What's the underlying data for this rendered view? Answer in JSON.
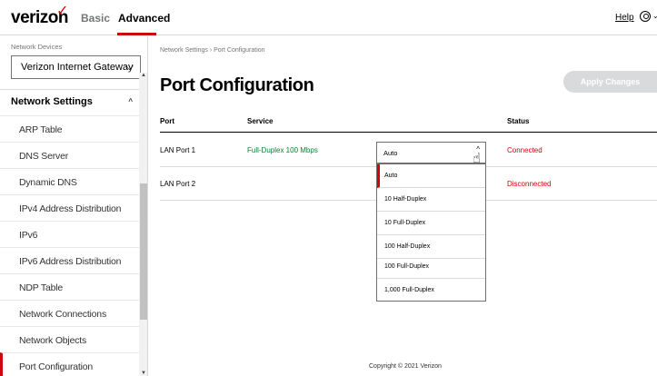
{
  "topnav": {
    "logo": "verizon",
    "logo_mark": "✓",
    "tabs": [
      {
        "label": "Basic"
      },
      {
        "label": "Advanced"
      }
    ],
    "help": "Help",
    "user_icon": "user-circle-icon"
  },
  "sidebar": {
    "devices_label": "Network Devices",
    "device_selected": "Verizon Internet Gateway",
    "group_title": "Network Settings",
    "items": [
      {
        "label": "ARP Table"
      },
      {
        "label": "DNS Server"
      },
      {
        "label": "Dynamic DNS"
      },
      {
        "label": "IPv4 Address Distribution"
      },
      {
        "label": "IPv6"
      },
      {
        "label": "IPv6 Address Distribution"
      },
      {
        "label": "NDP Table"
      },
      {
        "label": "Network Connections"
      },
      {
        "label": "Network Objects"
      },
      {
        "label": "Port Configuration"
      }
    ]
  },
  "main": {
    "breadcrumb": "Network Settings  ›  Port Configuration",
    "title": "Port Configuration",
    "apply_label": "Apply Changes",
    "headers": {
      "port": "Port",
      "service": "Service",
      "status": "Status"
    },
    "rows": [
      {
        "port": "LAN Port 1",
        "service": "Full-Duplex 100 Mbps",
        "speed": "Auto",
        "status": "Connected"
      },
      {
        "port": "LAN Port 2",
        "service": "",
        "speed": "",
        "status": "Disconnected"
      }
    ],
    "speed_options": [
      "Auto",
      "10 Half-Duplex",
      "10 Full-Duplex",
      "100 Half-Duplex",
      "100 Full-Duplex",
      "1,000 Full-Duplex"
    ]
  },
  "footer": {
    "copyright": "Copyright © 2021 Verizon"
  },
  "colors": {
    "accent": "#cd040b",
    "service": "#008331",
    "disabled_button": "#d8dadb"
  }
}
